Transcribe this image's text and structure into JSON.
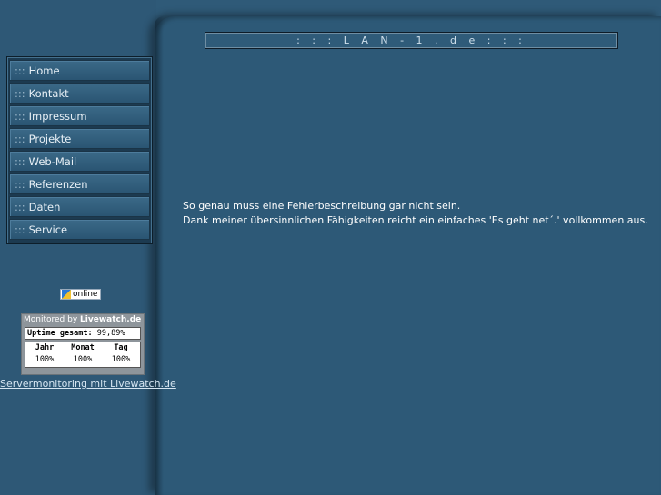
{
  "header": {
    "title": ": : :  L A N - 1 . d e  : : :"
  },
  "nav": {
    "prefix": ":::",
    "items": [
      {
        "label": "Home"
      },
      {
        "label": "Kontakt"
      },
      {
        "label": "Impressum"
      },
      {
        "label": "Projekte"
      },
      {
        "label": "Web-Mail"
      },
      {
        "label": "Referenzen"
      },
      {
        "label": "Daten"
      },
      {
        "label": "Service"
      }
    ]
  },
  "online_badge": {
    "label": "online"
  },
  "livewatch": {
    "monitored_by": "Monitored by",
    "brand": "Livewatch.de",
    "uptime_label": "Uptime gesamt:",
    "uptime_value": "99,89%",
    "columns": [
      {
        "header": "Jahr",
        "value": "100%"
      },
      {
        "header": "Monat",
        "value": "100%"
      },
      {
        "header": "Tag",
        "value": "100%"
      }
    ],
    "link_text": "Servermonitoring mit Livewatch.de"
  },
  "message": {
    "line1": "So genau muss eine Fehlerbeschreibung gar nicht sein.",
    "line2": "Dank meiner übersinnlichen Fähigkeiten reicht ein einfaches 'Es geht net´.' vollkommen aus."
  }
}
